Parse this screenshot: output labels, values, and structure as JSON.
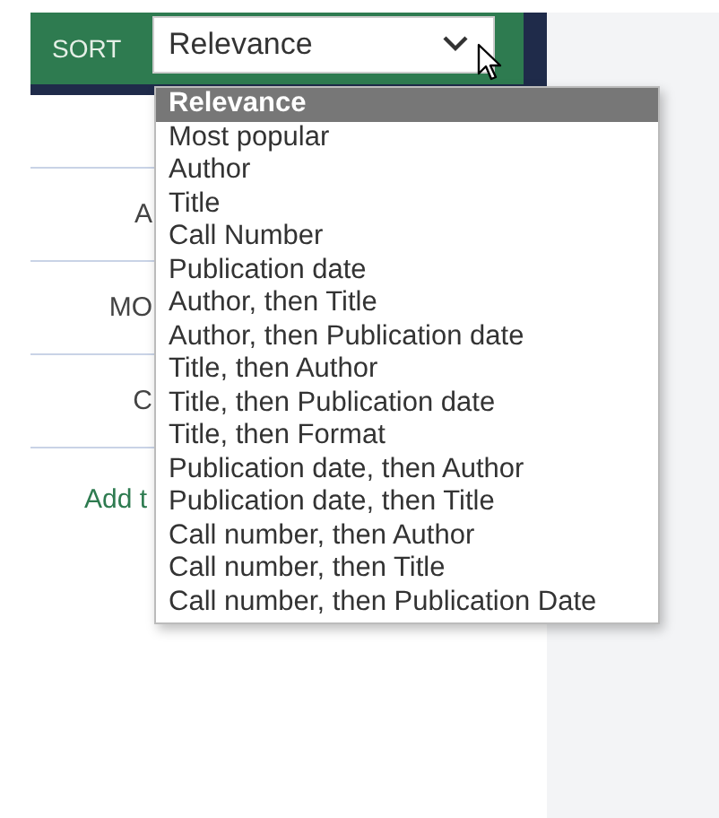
{
  "sort": {
    "label": "SORT",
    "value": "Relevance"
  },
  "left_panel": {
    "texts": [
      "A",
      "MO",
      "C"
    ],
    "link": "Add t"
  },
  "options": [
    {
      "label": "Relevance",
      "selected": true
    },
    {
      "label": "Most popular",
      "selected": false
    },
    {
      "label": "Author",
      "selected": false
    },
    {
      "label": "Title",
      "selected": false
    },
    {
      "label": "Call Number",
      "selected": false
    },
    {
      "label": "Publication date",
      "selected": false
    },
    {
      "label": "Author, then Title",
      "selected": false
    },
    {
      "label": "Author, then Publication date",
      "selected": false
    },
    {
      "label": "Title, then Author",
      "selected": false
    },
    {
      "label": "Title, then Publication date",
      "selected": false
    },
    {
      "label": "Title, then Format",
      "selected": false
    },
    {
      "label": "Publication date, then Author",
      "selected": false
    },
    {
      "label": "Publication date, then Title",
      "selected": false
    },
    {
      "label": "Call number, then Author",
      "selected": false
    },
    {
      "label": "Call number, then Title",
      "selected": false
    },
    {
      "label": "Call number, then Publication Date",
      "selected": false
    }
  ]
}
